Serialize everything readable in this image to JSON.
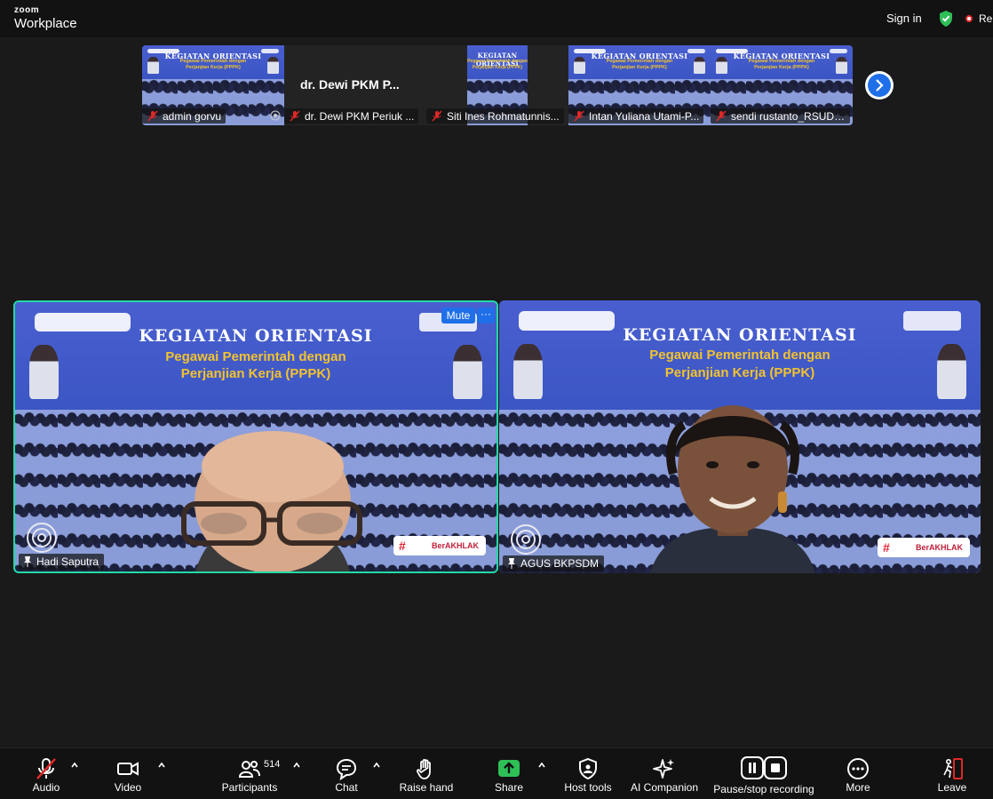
{
  "app": {
    "logo_line1": "zoom",
    "logo_line2": "Workplace",
    "sign_in": "Sign in",
    "recording_label": "Re"
  },
  "thumbnails": [
    {
      "name": "admin gorvu",
      "mirrored": true
    },
    {
      "name": "dr. Dewi PKM Periuk ...",
      "title": "dr. Dewi PKM P...",
      "video_off": true
    },
    {
      "name": "Siti Ines Rohmatunnis..."
    },
    {
      "name": "Intan Yuliana Utami-P..."
    },
    {
      "name": "sendi rustanto_RSUD ..."
    }
  ],
  "poster": {
    "title": "KEGIATAN ORIENTASI",
    "subtitle_line1": "Pegawai Pemerintah dengan",
    "subtitle_line2": "Perjanjian Kerja (PPPK)",
    "brand": "BerAKHLAK"
  },
  "tiles": [
    {
      "name": "Hadi Saputra",
      "active_speaker": true
    },
    {
      "name": "AGUS BKPSDM"
    }
  ],
  "tile_controls": {
    "mute": "Mute",
    "more": "···"
  },
  "toolbar": {
    "audio": "Audio",
    "video": "Video",
    "participants": "Participants",
    "participants_count": "514",
    "chat": "Chat",
    "raise_hand": "Raise hand",
    "share": "Share",
    "host_tools": "Host tools",
    "ai_companion": "AI Companion",
    "recording": "Pause/stop recording",
    "more": "More",
    "leave": "Leave"
  },
  "colors": {
    "accent_blue": "#1f6fe8",
    "share_green": "#2fbf57",
    "active_speaker_border": "#23d9a5",
    "mute_red": "#e02828",
    "leave_red": "#e02828"
  }
}
